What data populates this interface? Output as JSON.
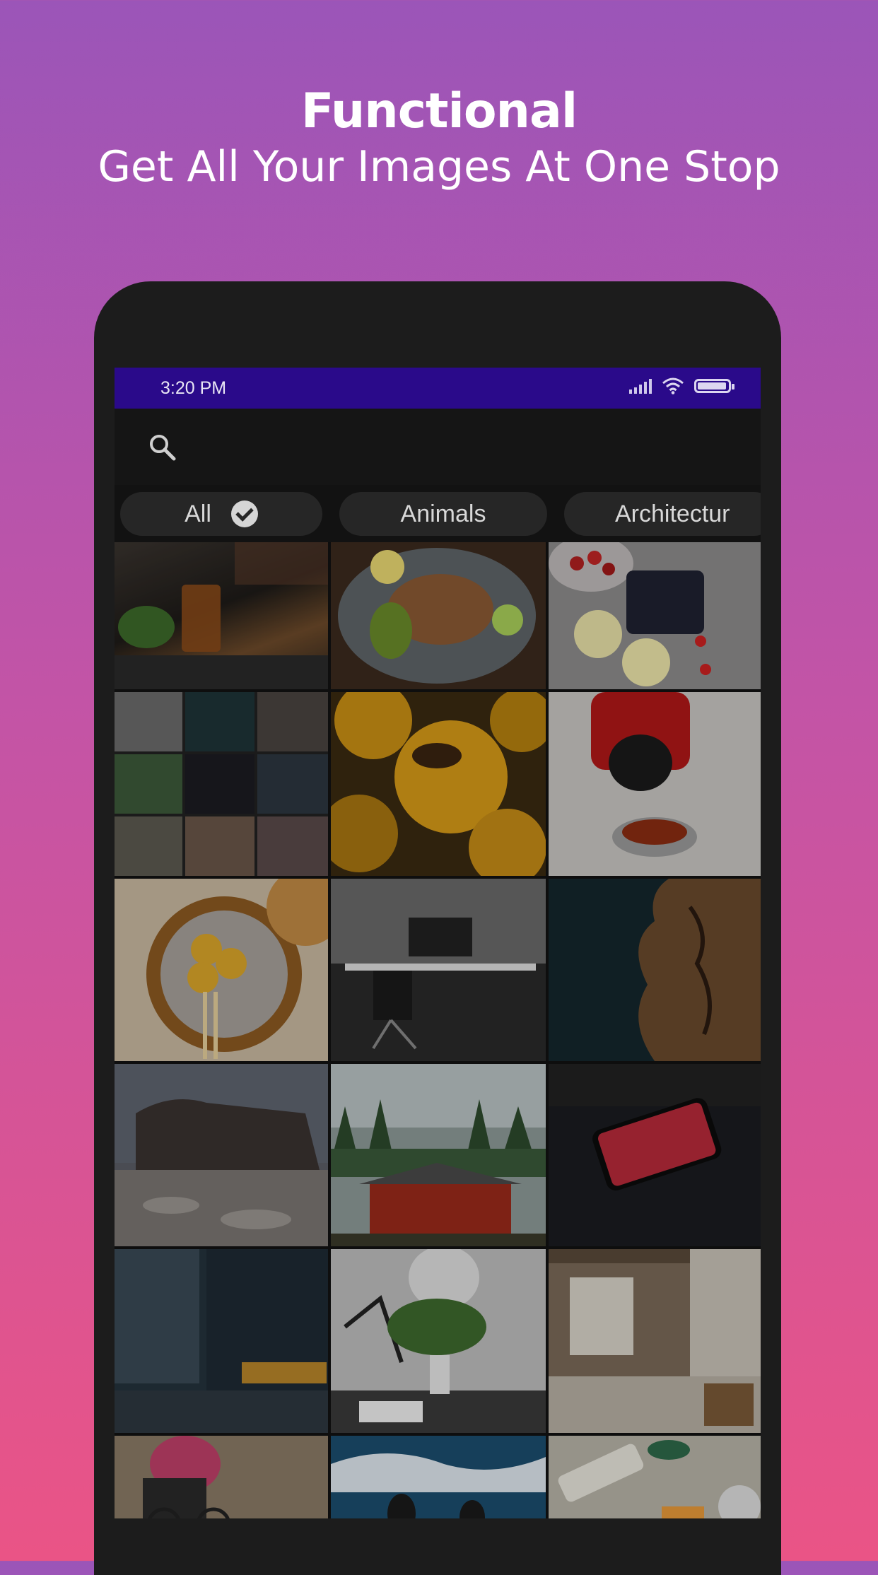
{
  "promo": {
    "title": "Functional",
    "subtitle": "Get All Your Images At One Stop"
  },
  "statusbar": {
    "time": "3:20 PM",
    "icons": [
      "signal-icon",
      "wifi-icon",
      "battery-icon"
    ]
  },
  "search": {
    "icon": "search-icon"
  },
  "chips": [
    {
      "label": "All",
      "selected": true
    },
    {
      "label": "Animals",
      "selected": false
    },
    {
      "label": "Architectur",
      "selected": false
    }
  ],
  "gallery": {
    "images": [
      "drink-on-tray",
      "grilled-chicken-plate",
      "strawberries-blueberries",
      "collage-thumbnails",
      "bee-on-yellow-flowers",
      "dog-in-red-shirt",
      "dumplings-basket",
      "desk-workspace",
      "tree-bark-closeup",
      "colosseum",
      "japanese-temple",
      "smartphone-on-keyboard",
      "city-buildings",
      "desk-lamp-plant",
      "kitchen-interior",
      "cyclist",
      "surfers-waves",
      "skincare-products"
    ]
  },
  "colors": {
    "statusbar": "#2a0a8a",
    "background_top": "#9b55b8",
    "background_bottom": "#ea5486",
    "chip": "#262626"
  }
}
